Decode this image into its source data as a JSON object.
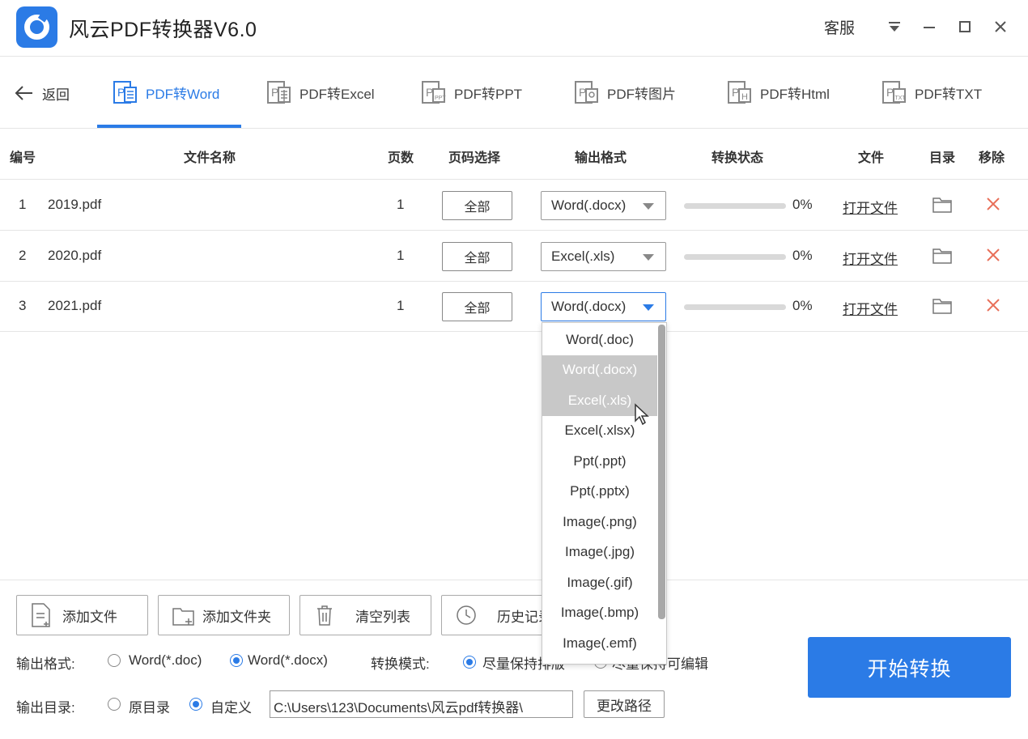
{
  "app": {
    "title": "风云PDF转换器V6.0",
    "service_label": "客服"
  },
  "nav": {
    "back_label": "返回",
    "tabs": [
      {
        "label": "PDF转Word",
        "active": true
      },
      {
        "label": "PDF转Excel",
        "active": false
      },
      {
        "label": "PDF转PPT",
        "active": false
      },
      {
        "label": "PDF转图片",
        "active": false
      },
      {
        "label": "PDF转Html",
        "active": false
      },
      {
        "label": "PDF转TXT",
        "active": false
      }
    ]
  },
  "table": {
    "headers": {
      "index": "编号",
      "filename": "文件名称",
      "pages": "页数",
      "page_range": "页码选择",
      "output_format": "输出格式",
      "status": "转换状态",
      "file": "文件",
      "folder": "目录",
      "remove": "移除"
    },
    "rows": [
      {
        "index": "1",
        "filename": "2019.pdf",
        "pages": "1",
        "range": "全部",
        "format": "Word(.docx)",
        "progress": 0,
        "progress_text": "0%",
        "open_label": "打开文件"
      },
      {
        "index": "2",
        "filename": "2020.pdf",
        "pages": "1",
        "range": "全部",
        "format": "Excel(.xls)",
        "progress": 0,
        "progress_text": "0%",
        "open_label": "打开文件"
      },
      {
        "index": "3",
        "filename": "2021.pdf",
        "pages": "1",
        "range": "全部",
        "format": "Word(.docx)",
        "progress": 0,
        "progress_text": "0%",
        "open_label": "打开文件"
      }
    ]
  },
  "dropdown": {
    "options": [
      "Word(.doc)",
      "Word(.docx)",
      "Excel(.xls)",
      "Excel(.xlsx)",
      "Ppt(.ppt)",
      "Ppt(.pptx)",
      "Image(.png)",
      "Image(.jpg)",
      "Image(.gif)",
      "Image(.bmp)",
      "Image(.emf)"
    ],
    "highlighted": [
      "Word(.docx)",
      "Excel(.xls)"
    ]
  },
  "toolbar": {
    "add_file": "添加文件",
    "add_folder": "添加文件夹",
    "clear_list": "清空列表",
    "history": "历史记录"
  },
  "options": {
    "output_format_label": "输出格式:",
    "format_doc": "Word(*.doc)",
    "format_docx": "Word(*.docx)",
    "selected_format": "Word(*.docx)",
    "mode_label": "转换模式:",
    "mode_keep_layout": "尽量保持排版",
    "mode_editable": "尽量保持可编辑",
    "output_dir_label": "输出目录:",
    "dir_original": "原目录",
    "dir_custom": "自定义",
    "selected_dir": "自定义",
    "path_value": "C:\\Users\\123\\Documents\\风云pdf转换器\\",
    "change_path": "更改路径"
  },
  "start_label": "开始转换",
  "colors": {
    "accent": "#2b7be6",
    "remove": "#e8705a",
    "highlight": "#c8c8c8"
  }
}
